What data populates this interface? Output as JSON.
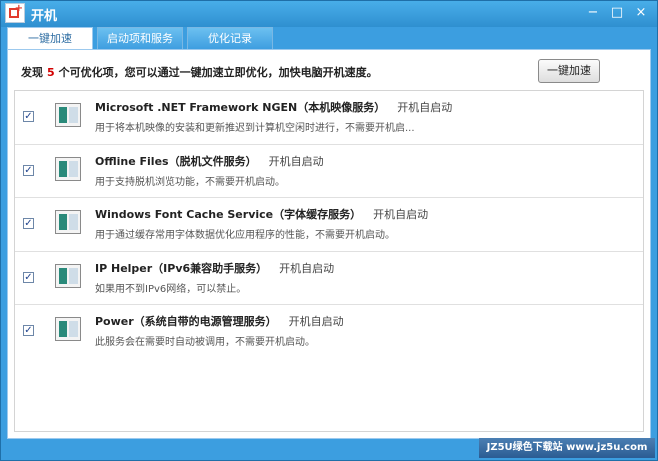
{
  "window": {
    "title": "开机",
    "controls": [
      "−",
      "□",
      "×"
    ]
  },
  "tabs": [
    {
      "label": "一键加速",
      "active": true
    },
    {
      "label": "启动项和服务",
      "active": false
    },
    {
      "label": "优化记录",
      "active": false
    }
  ],
  "summary": {
    "prefix": "发现",
    "count": "5",
    "suffix": "个可优化项，您可以通过一键加速立即优化，加快电脑开机速度。"
  },
  "boost_button": "一键加速",
  "services": [
    {
      "name": "Microsoft .NET Framework NGEN（本机映像服务）",
      "status": "开机自启动",
      "desc": "用于将本机映像的安装和更新推迟到计算机空闲时进行，不需要开机启...",
      "checked": true
    },
    {
      "name": "Offline Files（脱机文件服务）",
      "status": "开机自启动",
      "desc": "用于支持脱机浏览功能，不需要开机启动。",
      "checked": true
    },
    {
      "name": "Windows Font Cache Service（字体缓存服务）",
      "status": "开机自启动",
      "desc": "用于通过缓存常用字体数据优化应用程序的性能，不需要开机启动。",
      "checked": true
    },
    {
      "name": "IP Helper（IPv6兼容助手服务）",
      "status": "开机自启动",
      "desc": "如果用不到IPv6网络，可以禁止。",
      "checked": true
    },
    {
      "name": "Power（系统自带的电源管理服务）",
      "status": "开机自启动",
      "desc": "此服务会在需要时自动被调用，不需要开机启动。",
      "checked": true
    }
  ],
  "watermark": "JZ5U绿色下载站 www.jz5u.com",
  "colors": {
    "title_bar": "#2f8fd0",
    "count_highlight": "#d20000"
  }
}
